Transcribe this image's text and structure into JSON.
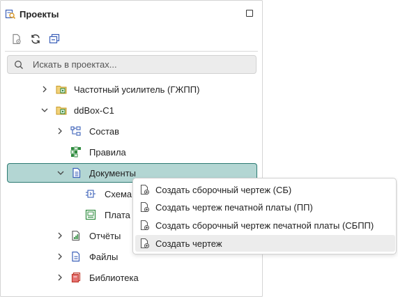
{
  "panel": {
    "title": "Проекты",
    "title_icon": "projects-search-icon",
    "maximize_icon": "maximize-icon",
    "toolbar": [
      {
        "name": "new-project-icon"
      },
      {
        "name": "refresh-icon"
      },
      {
        "name": "collapse-all-icon"
      }
    ],
    "search": {
      "placeholder": "Искать в проектах..."
    }
  },
  "tree": {
    "items": [
      {
        "label": "Частотный усилитель (ГЖПП)",
        "icon": "project-icon",
        "expanded": false
      },
      {
        "label": "ddBox-C1",
        "icon": "project-icon",
        "expanded": true
      },
      {
        "label": "Состав",
        "icon": "composition-icon",
        "expanded": false
      },
      {
        "label": "Правила",
        "icon": "rules-icon"
      },
      {
        "label": "Документы",
        "icon": "documents-icon",
        "expanded": true,
        "selected": true
      },
      {
        "label": "Схема",
        "icon": "schematic-icon"
      },
      {
        "label": "Плата",
        "icon": "board-icon"
      },
      {
        "label": "Отчёты",
        "icon": "reports-icon",
        "expanded": false
      },
      {
        "label": "Файлы",
        "icon": "files-icon",
        "expanded": false
      },
      {
        "label": "Библиотека",
        "icon": "library-icon",
        "expanded": false
      }
    ]
  },
  "context_menu": {
    "items": [
      {
        "label": "Создать сборочный чертеж (СБ)",
        "icon": "new-drawing-icon"
      },
      {
        "label": "Создать чертеж печатной платы (ПП)",
        "icon": "new-drawing-icon"
      },
      {
        "label": "Создать сборочный чертеж печатной платы (СБПП)",
        "icon": "new-drawing-icon"
      },
      {
        "label": "Создать чертеж",
        "icon": "new-drawing-icon",
        "hovered": true
      }
    ]
  },
  "colors": {
    "selection_bg": "#b3d6d3",
    "selection_border": "#2b7a72",
    "folder_yellow": "#d9b43a",
    "project_green": "#2e8b3e",
    "icon_blue": "#3a5fb8"
  }
}
